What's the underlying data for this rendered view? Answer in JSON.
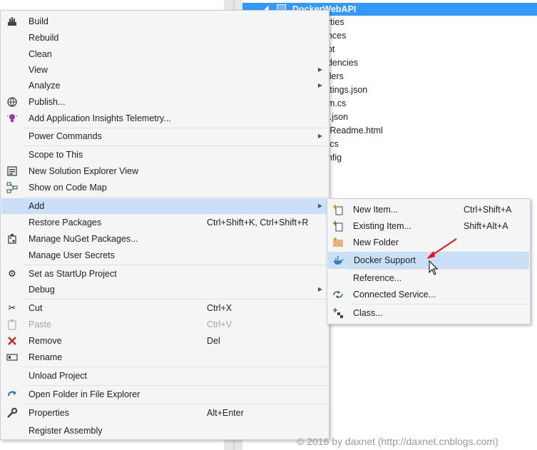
{
  "explorer": {
    "project_name": "DockerWebAPI",
    "items": [
      "erties",
      "ences",
      "oot",
      "ndencies",
      "ollers",
      "ettings.json",
      "am.cs",
      "ct.json",
      "t_Readme.html",
      "p.cs",
      "onfig"
    ]
  },
  "context_menu": {
    "build": "Build",
    "rebuild": "Rebuild",
    "clean": "Clean",
    "view": "View",
    "analyze": "Analyze",
    "publish": "Publish...",
    "insights": "Add Application Insights Telemetry...",
    "power_commands": "Power Commands",
    "scope": "Scope to This",
    "new_explorer_view": "New Solution Explorer View",
    "code_map": "Show on Code Map",
    "add": "Add",
    "restore": "Restore Packages",
    "restore_sc": "Ctrl+Shift+K, Ctrl+Shift+R",
    "nuget": "Manage NuGet Packages...",
    "user_secrets": "Manage User Secrets",
    "startup": "Set as StartUp Project",
    "debug": "Debug",
    "cut": "Cut",
    "cut_sc": "Ctrl+X",
    "paste": "Paste",
    "paste_sc": "Ctrl+V",
    "remove": "Remove",
    "remove_sc": "Del",
    "rename": "Rename",
    "unload": "Unload Project",
    "open_folder": "Open Folder in File Explorer",
    "properties": "Properties",
    "properties_sc": "Alt+Enter",
    "register": "Register Assembly"
  },
  "add_submenu": {
    "new_item": "New Item...",
    "new_item_sc": "Ctrl+Shift+A",
    "existing_item": "Existing Item...",
    "existing_item_sc": "Shift+Alt+A",
    "new_folder": "New Folder",
    "docker_support": "Docker Support",
    "reference": "Reference...",
    "connected_service": "Connected Service...",
    "class": "Class..."
  },
  "colors": {
    "selection": "#3399ff",
    "menu_highlight": "#c9e0f7",
    "arrow": "#e8121a"
  },
  "watermark": "© 2016 by daxnet (http://daxnet.cnblogs.com)"
}
